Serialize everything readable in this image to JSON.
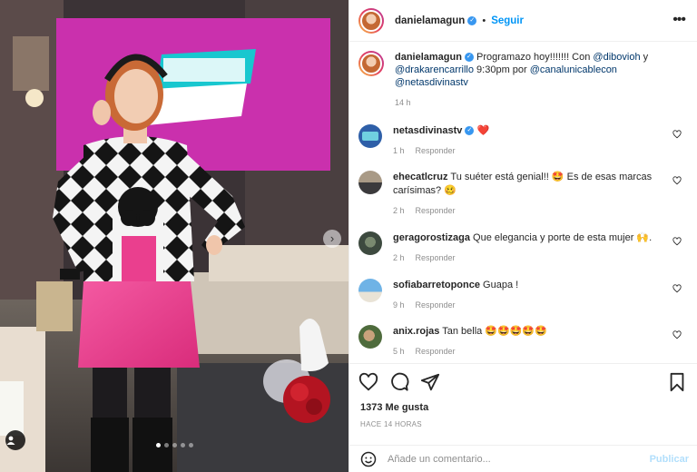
{
  "post": {
    "author": "danielamagun",
    "follow_label": "Seguir",
    "separator": "•",
    "more_label": "•••",
    "carousel": {
      "slide_count": 5,
      "active_index": 0
    }
  },
  "caption": {
    "author": "danielamagun",
    "text_1": "Programazo hoy!!!!!!! Con ",
    "mention_1": "@dibovioh",
    "text_2": " y ",
    "mention_2": "@drakarencarrillo",
    "text_3": " 9:30pm por ",
    "mention_3": "@canalunicablecon",
    "text_4": " ",
    "mention_4": "@netasdivinastv",
    "time": "14 h"
  },
  "comments": [
    {
      "user": "netasdivinastv",
      "text": "",
      "emoji": "❤️",
      "time": "1 h",
      "reply": "Responder",
      "verified": true
    },
    {
      "user": "ehecatlcruz",
      "text": "Tu suéter está genial!! 🤩 Es de esas marcas carísimas? 🥴",
      "emoji": "",
      "time": "2 h",
      "reply": "Responder",
      "verified": false
    },
    {
      "user": "geragorostizaga",
      "text": "Que elegancia y porte de esta mujer 🙌.",
      "emoji": "",
      "time": "2 h",
      "reply": "Responder",
      "verified": false
    },
    {
      "user": "sofiabarretoponce",
      "text": "Guapa !",
      "emoji": "",
      "time": "9 h",
      "reply": "Responder",
      "verified": false
    },
    {
      "user": "anix.rojas",
      "text": "Tan bella 🤩🤩🤩🤩🤩",
      "emoji": "",
      "time": "5 h",
      "reply": "Responder",
      "verified": false
    }
  ],
  "stats": {
    "likes": "1373 Me gusta",
    "date": "HACE 14 HORAS"
  },
  "comment_box": {
    "placeholder": "Añade un comentario...",
    "publish_label": "Publicar"
  },
  "colors": {
    "accent_blue": "#0095f6",
    "verified_blue": "#3897f0",
    "muted_text": "#8e8e8e",
    "skirt_pink": "#ea3f8e",
    "studio_magenta": "#c02ba5"
  }
}
